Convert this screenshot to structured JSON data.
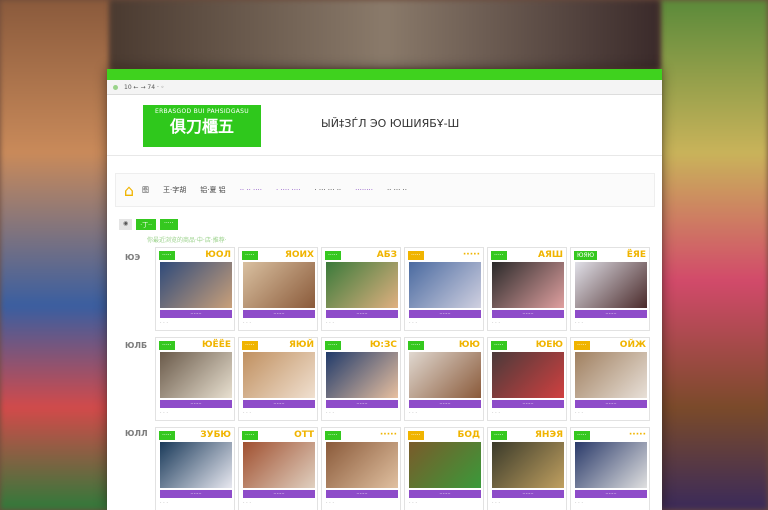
{
  "browser": {
    "address": "10 ← → 74 ·  ◦"
  },
  "header": {
    "logo_small": "ERBASGOD BUI PAHSIDGASU",
    "logo_big": "俱刀櫃五",
    "tagline": "ЫЙ‡ЗЃЛ ЭО ЮШИЯБҰ-Ш"
  },
  "nav": {
    "items": [
      "图",
      "王·字胡",
      "铝·夏 铝",
      "·· ·· ····",
      "· ···· ····",
      "· ··· ··· ··",
      "········",
      "·· ··· ··"
    ]
  },
  "filter": {
    "chips": [
      "·丁··",
      "·····"
    ],
    "crumb": "你最近浏览的商品·中·店·推荐·"
  },
  "rows": [
    {
      "label": "ЮЭ"
    },
    {
      "label": "ЮЛБ"
    },
    {
      "label": "ЮЛЛ"
    }
  ],
  "products": [
    {
      "tag": "·····",
      "price": "ЮОЛ",
      "bar": "·······",
      "meta": "· · ·"
    },
    {
      "tag": "·····",
      "price": "ЯОИХ",
      "bar": "·······",
      "meta": "· · ·"
    },
    {
      "tag": "·····",
      "price": "АБЗ",
      "bar": "·······",
      "meta": "· · ·"
    },
    {
      "tag": "·····",
      "price": "·····",
      "bar": "·······",
      "meta": "· · ·"
    },
    {
      "tag": "·····",
      "price": "АЯШ",
      "bar": "·······",
      "meta": "· · ·"
    },
    {
      "tag": "ЮЯЮ",
      "price": "ЁЯЕ",
      "bar": "·······",
      "meta": "· · ·"
    },
    {
      "tag": "·····",
      "price": "ЮЁЁЕ",
      "bar": "·······",
      "meta": "· · ·"
    },
    {
      "tag": "·····",
      "price": "ЯЮЙ",
      "bar": "·······",
      "meta": "· · ·"
    },
    {
      "tag": "·····",
      "price": "Ю:ЗС",
      "bar": "·······",
      "meta": "· · ·"
    },
    {
      "tag": "·····",
      "price": "ЮЮ",
      "bar": "·······",
      "meta": "· · ·"
    },
    {
      "tag": "·····",
      "price": "ЮЕЮ",
      "bar": "·······",
      "meta": "· · ·"
    },
    {
      "tag": "·····",
      "price": "ОЙЖ",
      "bar": "·······",
      "meta": "· · ·"
    },
    {
      "tag": "·····",
      "price": "ЗУБЮ",
      "bar": "·······",
      "meta": "· · ·"
    },
    {
      "tag": "·····",
      "price": "ОТТ",
      "bar": "·······",
      "meta": "· · ·"
    },
    {
      "tag": "·····",
      "price": "·····",
      "bar": "·······",
      "meta": "· · ·"
    },
    {
      "tag": "·····",
      "price": "БОД",
      "bar": "·······",
      "meta": "· · ·"
    },
    {
      "tag": "·····",
      "price": "ЯНЭЯ",
      "bar": "·······",
      "meta": "· · ·"
    },
    {
      "tag": "·····",
      "price": "·····",
      "bar": "·······",
      "meta": "· · ·"
    }
  ],
  "colors": {
    "accent_green": "#35c81f",
    "accent_purple": "#8e4cc9",
    "accent_yellow": "#f0b400"
  }
}
